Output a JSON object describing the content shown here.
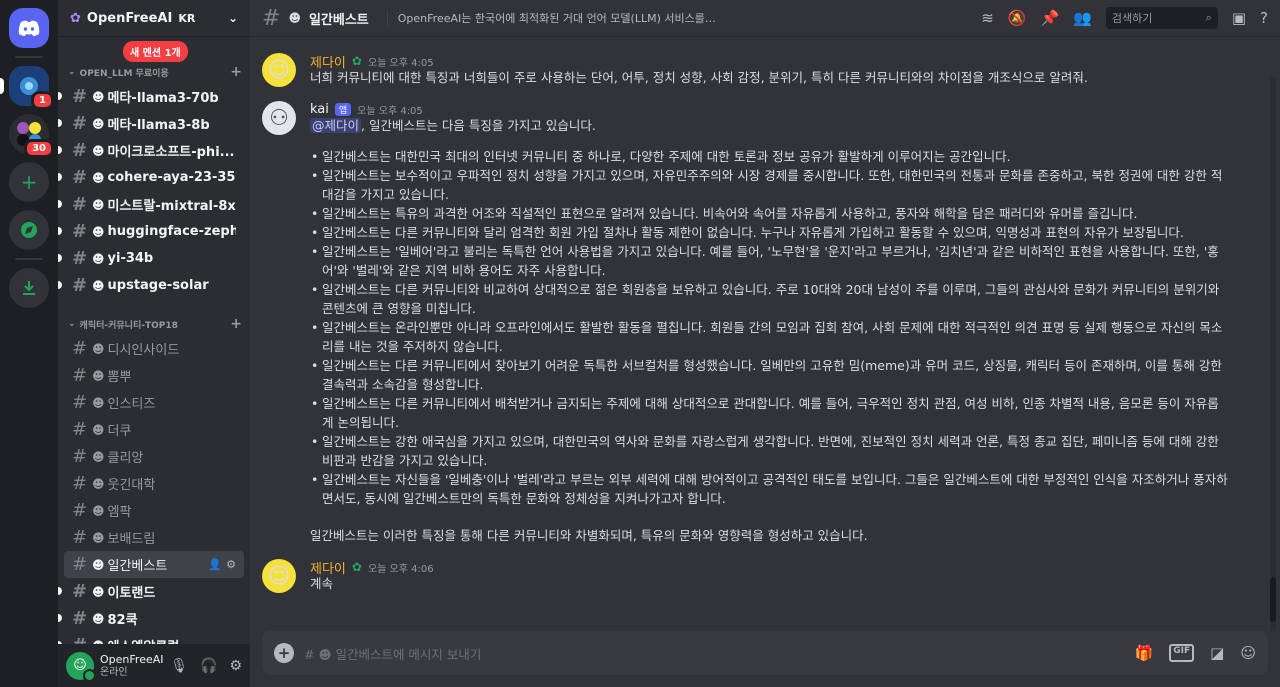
{
  "server": {
    "name": "OpenFreeAI",
    "region_flag": "KR",
    "new_mentions": "새 멘션 1개",
    "badges": {
      "first": "1",
      "second": "30"
    }
  },
  "categories": [
    {
      "label": "OPEN_LLM 무료이용",
      "channels": [
        {
          "label": "메타-llama3-70b",
          "unread": true
        },
        {
          "label": "메타-llama3-8b",
          "unread": true
        },
        {
          "label": "마이크로소프트-phi...",
          "unread": true
        },
        {
          "label": "cohere-aya-23-35b",
          "unread": true
        },
        {
          "label": "미스트랄-mixtral-8x7b",
          "unread": true
        },
        {
          "label": "huggingface-zephyr-...",
          "unread": true
        },
        {
          "label": "yi-34b",
          "unread": true
        },
        {
          "label": "upstage-solar",
          "unread": true
        }
      ]
    },
    {
      "label": "캐릭터-커뮤니티-TOP18",
      "channels": [
        {
          "label": "디시인사이드",
          "unread": false
        },
        {
          "label": "뽐뿌",
          "unread": false
        },
        {
          "label": "인스티즈",
          "unread": false
        },
        {
          "label": "더쿠",
          "unread": false
        },
        {
          "label": "클리앙",
          "unread": false
        },
        {
          "label": "웃긴대학",
          "unread": false
        },
        {
          "label": "엠팍",
          "unread": false
        },
        {
          "label": "보배드림",
          "unread": false
        },
        {
          "label": "일간베스트",
          "unread": false,
          "active": true
        },
        {
          "label": "이토랜드",
          "unread": true
        },
        {
          "label": "82쿡",
          "unread": true
        },
        {
          "label": "에스엘알클럽",
          "unread": true
        }
      ]
    }
  ],
  "user": {
    "name": "OpenFreeAI",
    "status": "온라인"
  },
  "header": {
    "channel": "일간베스트",
    "topic": "OpenFreeAI는 한국어에 최적화된 거대 언어 모델(LLM) 서비스를 개발하였고 이를 위해 한글과 한국정성에 특화...",
    "search_placeholder": "검색하기"
  },
  "messages": {
    "m1": {
      "author": "제다이",
      "time": "오늘 오후 4:05",
      "text": "너희 커뮤니티에 대한 특징과 너희들이 주로 사용하는 단어, 어투, 정치 성향, 사회 감정, 분위기, 특히 다른 커뮤니티와의 차이점을 개조식으로 알려줘."
    },
    "m2": {
      "author": "kai",
      "app_tag": "앱",
      "time": "오늘 오후 4:05",
      "mention": "@제다이",
      "intro": ", 일간베스트는 다음 특징을 가지고 있습니다.",
      "points": [
        "일간베스트는 대한민국 최대의 인터넷 커뮤니티 중 하나로, 다양한 주제에 대한 토론과 정보 공유가 활발하게 이루어지는 공간입니다.",
        "일간베스트는 보수적이고 우파적인 정치 성향을 가지고 있으며, 자유민주주의와 시장 경제를 중시합니다. 또한, 대한민국의 전통과 문화를 존중하고, 북한 정권에 대한 강한 적대감을 가지고 있습니다.",
        "일간베스트는 특유의 과격한 어조와 직설적인 표현으로 알려져 있습니다. 비속어와 속어를 자유롭게 사용하고, 풍자와 해학을 담은 패러디와 유머를 즐깁니다.",
        "일간베스트는 다른 커뮤니티와 달리 엄격한 회원 가입 절차나 활동 제한이 없습니다. 누구나 자유롭게 가입하고 활동할 수 있으며, 익명성과 표현의 자유가 보장됩니다.",
        "일간베스트는 '일베어'라고 불리는 독특한 언어 사용법을 가지고 있습니다. 예를 들어, '노무현'을 '운지'라고 부르거나, '김치년'과 같은 비하적인 표현을 사용합니다. 또한, '홍어'와 '벌레'와 같은 지역 비하 용어도 자주 사용합니다.",
        "일간베스트는 다른 커뮤니티와 비교하여 상대적으로 젊은 회원층을 보유하고 있습니다. 주로 10대와 20대 남성이 주를 이루며, 그들의 관심사와 문화가 커뮤니티의 분위기와 콘텐츠에 큰 영향을 미칩니다.",
        "일간베스트는 온라인뿐만 아니라 오프라인에서도 활발한 활동을 펼칩니다. 회원들 간의 모임과 집회 참여, 사회 문제에 대한 적극적인 의견 표명 등 실제 행동으로 자신의 목소리를 내는 것을 주저하지 않습니다.",
        "일간베스트는 다른 커뮤니티에서 찾아보기 어려운 독특한 서브컬처를 형성했습니다. 일베만의 고유한 밈(meme)과 유머 코드, 상징물, 캐릭터 등이 존재하며, 이를 통해 강한 결속력과 소속감을 형성합니다.",
        "일간베스트는 다른 커뮤니티에서 배척받거나 금지되는 주제에 대해 상대적으로 관대합니다. 예를 들어, 극우적인 정치 관점, 여성 비하, 인종 차별적 내용, 음모론 등이 자유롭게 논의됩니다.",
        "일간베스트는 강한 애국심을 가지고 있으며, 대한민국의 역사와 문화를 자랑스럽게 생각합니다. 반면에, 진보적인 정치 세력과 언론, 특정 종교 집단, 페미니즘 등에 대해 강한 비판과 반감을 가지고 있습니다.",
        "일간베스트는 자신들을 '일베충'이나 '벌레'라고 부르는 외부 세력에 대해 방어적이고 공격적인 태도를 보입니다. 그들은 일간베스트에 대한 부정적인 인식을 자조하거나 풍자하면서도, 동시에 일간베스트만의 독특한 문화와 정체성을 지켜나가고자 합니다."
      ],
      "closing": "일간베스트는 이러한 특징을 통해 다른 커뮤니티와 차별화되며, 특유의 문화와 영향력을 형성하고 있습니다."
    },
    "m3": {
      "author": "제다이",
      "time": "오늘 오후 4:06",
      "text": "계속"
    }
  },
  "composer": {
    "placeholder": "일간베스트에 메시지 보내기"
  },
  "icons": {
    "gif_label": "GIF"
  }
}
